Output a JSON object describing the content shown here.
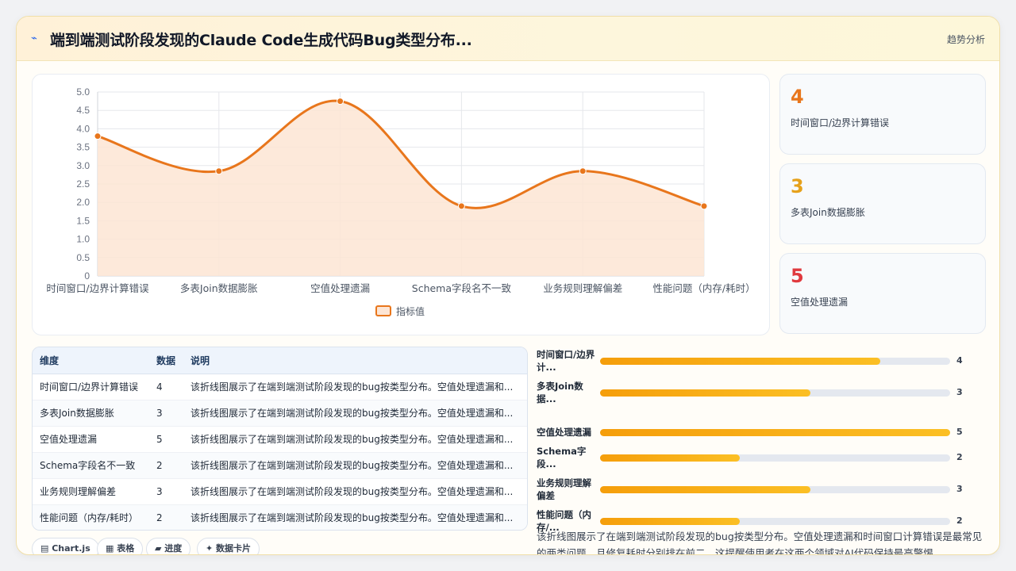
{
  "header": {
    "title": "端到端测试阶段发现的Claude Code生成代码Bug类型分布...",
    "link": "趋势分析"
  },
  "chart_data": {
    "type": "line",
    "categories": [
      "时间窗口/边界计算错误",
      "多表Join数据膨胀",
      "空值处理遗漏",
      "Schema字段名不一致",
      "业务规则理解偏差",
      "性能问题（内存/耗时）"
    ],
    "series": [
      {
        "name": "指标值",
        "values": [
          3.8,
          2.85,
          4.75,
          1.9,
          2.85,
          1.9
        ]
      }
    ],
    "ylim": [
      0,
      5
    ],
    "yticks": [
      "0",
      "0.5",
      "1.0",
      "1.5",
      "2.0",
      "2.5",
      "3.0",
      "3.5",
      "4.0",
      "4.5",
      "5.0"
    ],
    "grid": true,
    "legend": "bottom",
    "line_color": "#e8761c",
    "fill_color": "#fde5d4"
  },
  "stats": [
    {
      "value": "4",
      "label": "时间窗口/边界计算错误",
      "color": "#e8761c"
    },
    {
      "value": "3",
      "label": "多表Join数据膨胀",
      "color": "#e6a11a"
    },
    {
      "value": "5",
      "label": "空值处理遗漏",
      "color": "#e0393e"
    }
  ],
  "table": {
    "headers": [
      "维度",
      "数据",
      "说明"
    ],
    "rows": [
      [
        "时间窗口/边界计算错误",
        "4",
        "该折线图展示了在端到端测试阶段发现的bug按类型分布。空值处理遗漏和..."
      ],
      [
        "多表Join数据膨胀",
        "3",
        "该折线图展示了在端到端测试阶段发现的bug按类型分布。空值处理遗漏和..."
      ],
      [
        "空值处理遗漏",
        "5",
        "该折线图展示了在端到端测试阶段发现的bug按类型分布。空值处理遗漏和..."
      ],
      [
        "Schema字段名不一致",
        "2",
        "该折线图展示了在端到端测试阶段发现的bug按类型分布。空值处理遗漏和..."
      ],
      [
        "业务规则理解偏差",
        "3",
        "该折线图展示了在端到端测试阶段发现的bug按类型分布。空值处理遗漏和..."
      ],
      [
        "性能问题（内存/耗时）",
        "2",
        "该折线图展示了在端到端测试阶段发现的bug按类型分布。空值处理遗漏和..."
      ]
    ]
  },
  "tabs": [
    {
      "label": "Chart.js",
      "icon": "chart-icon"
    },
    {
      "label": "表格",
      "icon": "table-icon"
    },
    {
      "label": "进度",
      "icon": "progress-icon"
    },
    {
      "label": "数据卡片",
      "icon": "sparkle-icon"
    }
  ],
  "bars": [
    {
      "label": "时间窗口/边界计...",
      "value": 4
    },
    {
      "label": "多表Join数据...",
      "value": 3
    },
    {
      "label": "空值处理遗漏",
      "value": 5
    },
    {
      "label": "Schema字段...",
      "value": 2
    },
    {
      "label": "业务规则理解偏差",
      "value": 3
    },
    {
      "label": "性能问题（内存/...",
      "value": 2
    }
  ],
  "bar_max": 5,
  "description": "该折线图展示了在端到端测试阶段发现的bug按类型分布。空值处理遗漏和时间窗口计算错误是最常见的两类问题，且修复耗时分别排在前二。这提醒使用者在这两个领域对AI代码保持最高警惕。"
}
